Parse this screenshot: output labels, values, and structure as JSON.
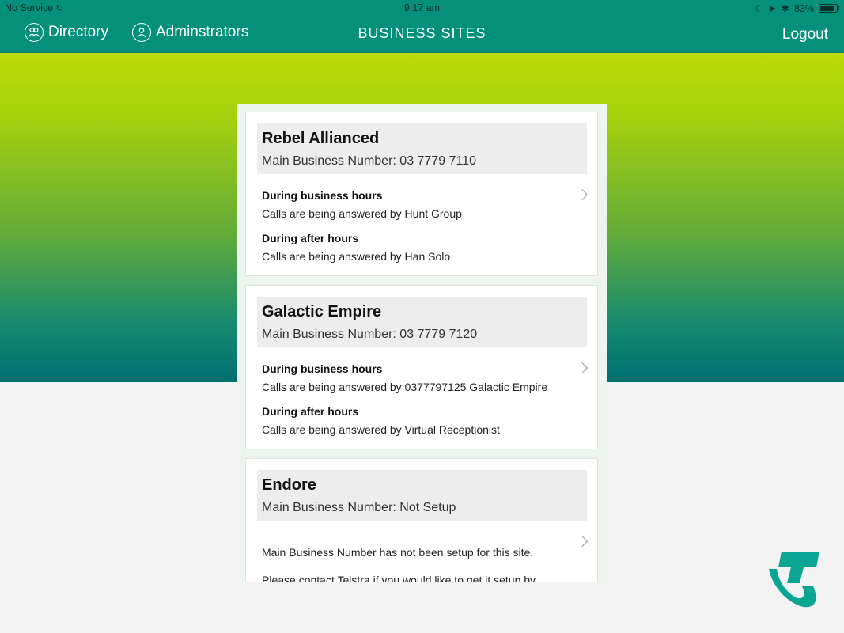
{
  "status_bar": {
    "carrier": "No Service",
    "time": "9:17 am",
    "battery": "83%",
    "battery_level": 0.83
  },
  "nav": {
    "directory_label": "Directory",
    "administrators_label": "Adminstrators",
    "title": "BUSINESS SITES",
    "logout_label": "Logout"
  },
  "sites": [
    {
      "name": "Rebel Allianced",
      "number": "Main Business Number: 03 7779 7110",
      "business_hours_label": "During business hours",
      "business_hours_text": "Calls are being answered by Hunt Group",
      "after_hours_label": "During after hours",
      "after_hours_text": "Calls are being answered by Han Solo"
    },
    {
      "name": "Galactic Empire",
      "number": "Main Business Number: 03 7779 7120",
      "business_hours_label": "During business hours",
      "business_hours_text": "Calls are being answered by 0377797125 Galactic Empire",
      "after_hours_label": "During after hours",
      "after_hours_text": "Calls are being answered by Virtual Receptionist"
    },
    {
      "name": "Endore",
      "number": "Main Business Number: Not Setup",
      "message_1": "Main Business Number has not been setup for this site.",
      "message_2": "Please contact Telstra if you would like to get it setup by"
    }
  ],
  "colors": {
    "nav_bar": "#05907b",
    "gradient_top": "#bddc07",
    "gradient_bottom": "#006f70",
    "logo": "#0aa693"
  },
  "icons": {
    "directory": "people-icon",
    "administrators": "person-icon",
    "row_action": "chevron-right-icon",
    "brand": "telstra-logo"
  }
}
